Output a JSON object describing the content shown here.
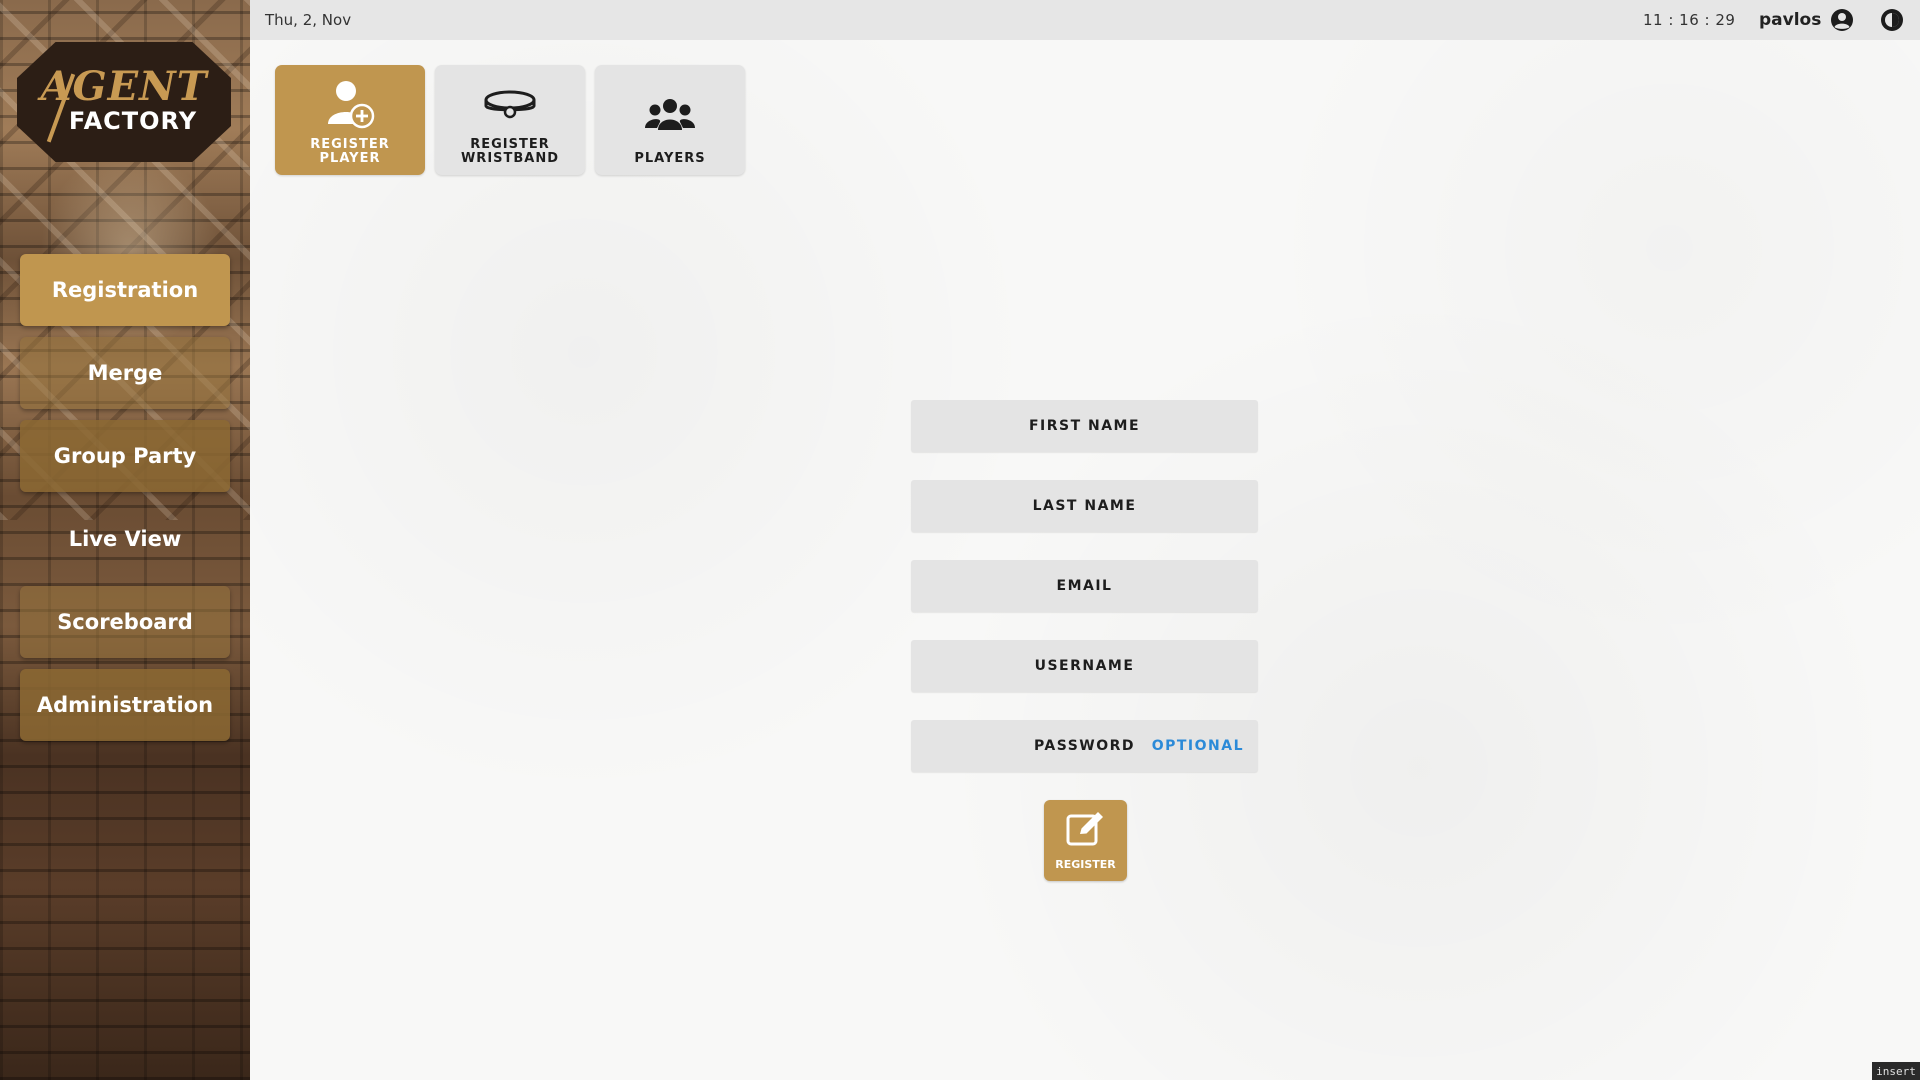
{
  "topbar": {
    "date": "Thu, 2, Nov",
    "clock": "11 : 16 : 29",
    "username": "pavlos"
  },
  "logo": {
    "line1": "AGENT",
    "line2": "FACTORY"
  },
  "sidebar": {
    "items": [
      {
        "label": "Registration"
      },
      {
        "label": "Merge"
      },
      {
        "label": "Group Party"
      },
      {
        "label": "Live View"
      },
      {
        "label": "Scoreboard"
      },
      {
        "label": "Administration"
      }
    ]
  },
  "tabs": [
    {
      "label": "REGISTER\nPLAYER",
      "icon": "user-plus-icon"
    },
    {
      "label": "REGISTER\nWRISTBAND",
      "icon": "wristband-icon"
    },
    {
      "label": "PLAYERS",
      "icon": "users-icon"
    }
  ],
  "form": {
    "first_name_placeholder": "FIRST NAME",
    "last_name_placeholder": "LAST NAME",
    "email_placeholder": "EMAIL",
    "username_placeholder": "USERNAME",
    "password_placeholder": "PASSWORD",
    "password_hint": "OPTIONAL",
    "register_label": "REGISTER"
  },
  "status": {
    "mode": "insert"
  },
  "colors": {
    "accent": "#c0964f",
    "optional": "#2b8ad8",
    "field_bg": "#e4e4e4"
  }
}
